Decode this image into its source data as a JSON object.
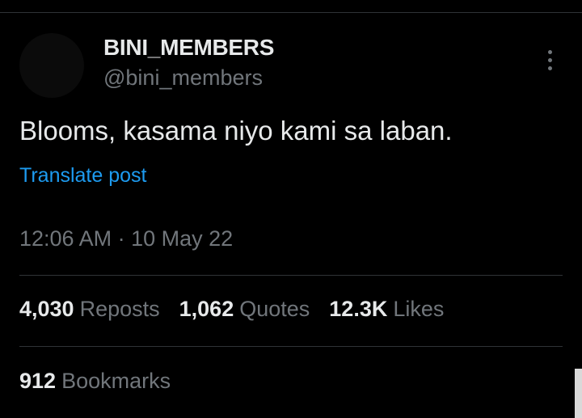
{
  "post": {
    "display_name": "BINI_MEMBERS",
    "handle": "@bini_members",
    "text": "Blooms, kasama niyo kami sa laban.",
    "translate_label": "Translate post",
    "timestamp": "12:06 AM · 10 May 22"
  },
  "stats": {
    "reposts": {
      "count": "4,030",
      "label": "Reposts"
    },
    "quotes": {
      "count": "1,062",
      "label": "Quotes"
    },
    "likes": {
      "count": "12.3K",
      "label": "Likes"
    },
    "bookmarks": {
      "count": "912",
      "label": "Bookmarks"
    }
  },
  "icons": {
    "more": "more-options-icon"
  },
  "colors": {
    "background": "#000000",
    "primary_text": "#e7e9ea",
    "secondary_text": "#71767b",
    "link": "#1d9bf0",
    "divider": "#2f3336"
  }
}
